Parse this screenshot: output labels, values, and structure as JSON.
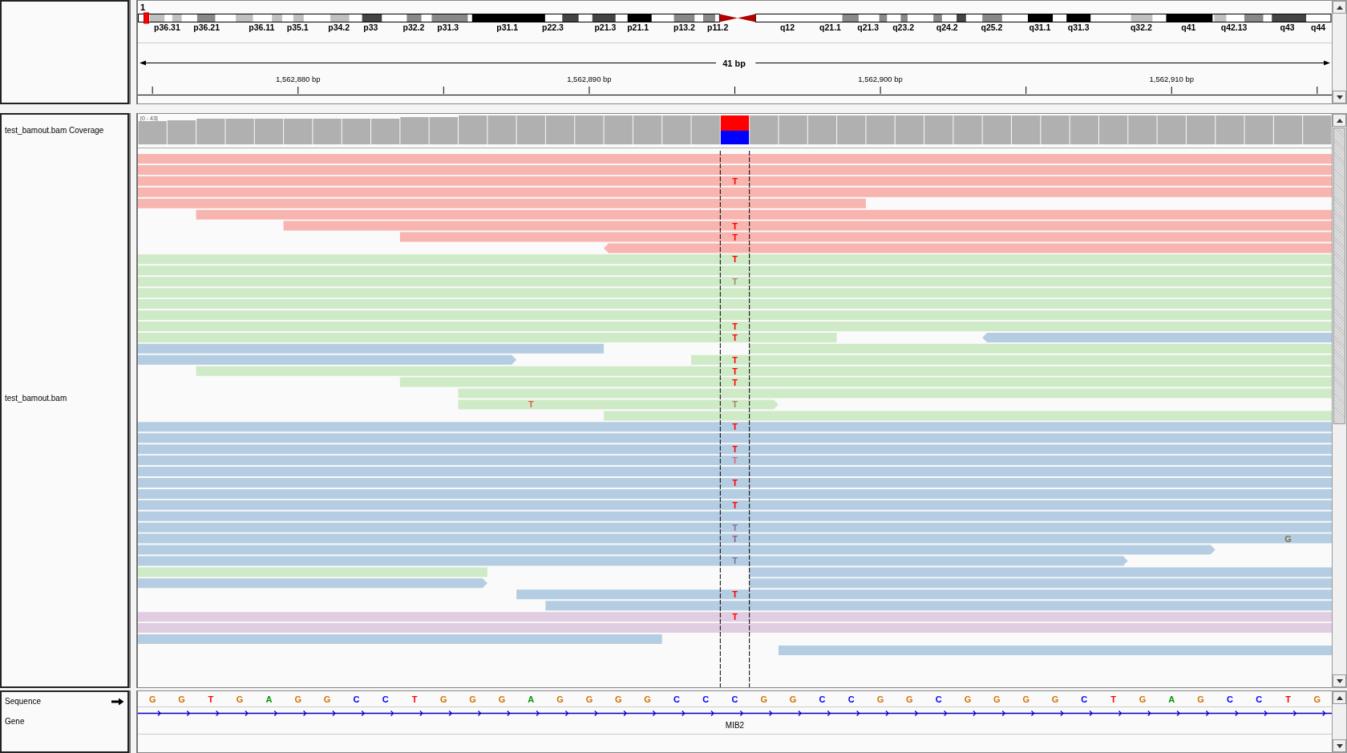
{
  "chromosome": {
    "name": "1",
    "bands": [
      "p36.31",
      "p36.21",
      "p36.11",
      "p35.1",
      "p34.2",
      "p33",
      "p32.2",
      "p31.3",
      "p31.1",
      "p22.3",
      "p21.3",
      "p21.1",
      "p13.2",
      "p11.2",
      "q12",
      "q21.1",
      "q21.3",
      "q23.2",
      "q24.2",
      "q25.2",
      "q31.1",
      "q31.3",
      "q32.2",
      "q41",
      "q42.13",
      "q43",
      "q44"
    ]
  },
  "ruler": {
    "span": "41 bp",
    "ticks": [
      "1,562,880 bp",
      "1,562,890 bp",
      "1,562,900 bp",
      "1,562,910 bp"
    ]
  },
  "coverage_track": {
    "name": "test_bamout.bam Coverage",
    "range_label": "[0 - 43]"
  },
  "alignment_track": {
    "name": "test_bamout.bam",
    "rows": [
      {
        "reads": [
          {
            "color": "#f8b4ae"
          }
        ]
      },
      {
        "reads": [
          {
            "color": "#f8b4ae"
          }
        ]
      },
      {
        "reads": [
          {
            "color": "#f8b4ae",
            "mismatches": [
              {
                "base": "T",
                "color": "#ff0000"
              }
            ]
          }
        ]
      },
      {
        "reads": [
          {
            "color": "#f8b4ae"
          }
        ]
      },
      {
        "reads": [
          {
            "color": "#f8b4ae"
          }
        ]
      },
      {
        "reads": [
          {
            "color": "#f8b4ae"
          }
        ]
      },
      {
        "reads": [
          {
            "color": "#f8b4ae",
            "mismatches": [
              {
                "base": "T",
                "color": "#ff0000"
              }
            ]
          }
        ]
      },
      {
        "reads": [
          {
            "color": "#f8b4ae",
            "mismatches": [
              {
                "base": "T",
                "color": "#ff0000"
              }
            ]
          }
        ]
      },
      {
        "reads": [
          {
            "color": "#f8b4ae"
          }
        ]
      },
      {
        "reads": [
          {
            "color": "#cfeac7",
            "mismatches": [
              {
                "base": "T",
                "color": "#ff0000"
              }
            ]
          }
        ]
      },
      {
        "reads": [
          {
            "color": "#cfeac7"
          }
        ]
      },
      {
        "reads": [
          {
            "color": "#cfeac7",
            "mismatches": [
              {
                "base": "T",
                "color": "#a88870"
              }
            ]
          }
        ]
      },
      {
        "reads": [
          {
            "color": "#cfeac7"
          }
        ]
      },
      {
        "reads": [
          {
            "color": "#cfeac7"
          }
        ]
      },
      {
        "reads": [
          {
            "color": "#cfeac7"
          }
        ]
      },
      {
        "reads": [
          {
            "color": "#cfeac7",
            "mismatches": [
              {
                "base": "T",
                "color": "#ff0000"
              }
            ]
          }
        ]
      },
      {
        "reads": [
          {
            "color": "#cfeac7",
            "mismatches": [
              {
                "base": "T",
                "color": "#ff0000"
              }
            ]
          },
          {
            "color": "#b4cde2"
          }
        ]
      },
      {
        "reads": [
          {
            "color": "#b4cde2"
          },
          {
            "color": "#cfeac7"
          }
        ]
      },
      {
        "reads": [
          {
            "color": "#b4cde2"
          },
          {
            "color": "#cfeac7",
            "mismatches": [
              {
                "base": "T",
                "color": "#ff0000"
              }
            ]
          }
        ]
      },
      {
        "reads": [
          {
            "color": "#cfeac7",
            "mismatches": [
              {
                "base": "T",
                "color": "#ff0000"
              }
            ]
          }
        ]
      },
      {
        "reads": [
          {
            "color": "#cfeac7",
            "mismatches": [
              {
                "base": "T",
                "color": "#ff0000"
              }
            ]
          }
        ]
      },
      {
        "reads": [
          {
            "color": "#cfeac7"
          }
        ]
      },
      {
        "reads": [
          {
            "color": "#cfeac7",
            "mismatches": [
              {
                "base": "T",
                "color": "#e0604f"
              },
              {
                "base": "T",
                "color": "#a08868"
              }
            ]
          }
        ]
      },
      {
        "reads": [
          {
            "color": "#cfeac7"
          }
        ]
      },
      {
        "reads": [
          {
            "color": "#b4cde2",
            "mismatches": [
              {
                "base": "T",
                "color": "#ff0000"
              }
            ]
          }
        ]
      },
      {
        "reads": [
          {
            "color": "#b4cde2"
          }
        ]
      },
      {
        "reads": [
          {
            "color": "#b4cde2",
            "mismatches": [
              {
                "base": "T",
                "color": "#ff0000"
              }
            ]
          }
        ]
      },
      {
        "reads": [
          {
            "color": "#b4cde2",
            "mismatches": [
              {
                "base": "T",
                "color": "#d86878"
              }
            ]
          }
        ]
      },
      {
        "reads": [
          {
            "color": "#b4cde2"
          }
        ]
      },
      {
        "reads": [
          {
            "color": "#b4cde2",
            "mismatches": [
              {
                "base": "T",
                "color": "#ff0000"
              }
            ]
          }
        ]
      },
      {
        "reads": [
          {
            "color": "#b4cde2"
          }
        ]
      },
      {
        "reads": [
          {
            "color": "#b4cde2",
            "mismatches": [
              {
                "base": "T",
                "color": "#ff0000"
              }
            ]
          }
        ]
      },
      {
        "reads": [
          {
            "color": "#b4cde2"
          }
        ]
      },
      {
        "reads": [
          {
            "color": "#b4cde2",
            "mismatches": [
              {
                "base": "T",
                "color": "#7e7298"
              }
            ]
          }
        ]
      },
      {
        "reads": [
          {
            "color": "#b4cde2",
            "mismatches": [
              {
                "base": "T",
                "color": "#8a5c80"
              },
              {
                "base": "G",
                "color": "#7e6c48"
              }
            ]
          }
        ]
      },
      {
        "reads": [
          {
            "color": "#b4cde2"
          }
        ]
      },
      {
        "reads": [
          {
            "color": "#b4cde2",
            "mismatches": [
              {
                "base": "T",
                "color": "#7e7298"
              }
            ]
          }
        ]
      },
      {
        "reads": [
          {
            "color": "#cfeac7"
          },
          {
            "color": "#b4cde2"
          }
        ]
      },
      {
        "reads": [
          {
            "color": "#b4cde2"
          },
          {
            "color": "#b4cde2"
          }
        ]
      },
      {
        "reads": [
          {
            "color": "#b4cde2",
            "mismatches": [
              {
                "base": "T",
                "color": "#ff0000"
              }
            ]
          }
        ]
      },
      {
        "reads": [
          {
            "color": "#b4cde2"
          }
        ]
      },
      {
        "reads": [
          {
            "color": "#e1cde2",
            "mismatches": [
              {
                "base": "T",
                "color": "#ff0000"
              }
            ]
          }
        ]
      },
      {
        "reads": [
          {
            "color": "#e1cde2"
          }
        ]
      },
      {
        "reads": [
          {
            "color": "#b4cde2"
          }
        ]
      },
      {
        "reads": [
          {
            "color": "#b4cde2"
          }
        ]
      }
    ]
  },
  "sequence_track": {
    "name": "Sequence",
    "bases": [
      {
        "base": "G",
        "color": "#d17105"
      },
      {
        "base": "G",
        "color": "#d17105"
      },
      {
        "base": "T",
        "color": "#ff0000"
      },
      {
        "base": "G",
        "color": "#d17105"
      },
      {
        "base": "A",
        "color": "#009600"
      },
      {
        "base": "G",
        "color": "#d17105"
      },
      {
        "base": "G",
        "color": "#d17105"
      },
      {
        "base": "C",
        "color": "#0000ff"
      },
      {
        "base": "C",
        "color": "#0000ff"
      },
      {
        "base": "T",
        "color": "#ff0000"
      },
      {
        "base": "G",
        "color": "#d17105"
      },
      {
        "base": "G",
        "color": "#d17105"
      },
      {
        "base": "G",
        "color": "#d17105"
      },
      {
        "base": "A",
        "color": "#009600"
      },
      {
        "base": "G",
        "color": "#d17105"
      },
      {
        "base": "G",
        "color": "#d17105"
      },
      {
        "base": "G",
        "color": "#d17105"
      },
      {
        "base": "G",
        "color": "#d17105"
      },
      {
        "base": "C",
        "color": "#0000ff"
      },
      {
        "base": "C",
        "color": "#0000ff"
      },
      {
        "base": "C",
        "color": "#0000ff"
      },
      {
        "base": "G",
        "color": "#d17105"
      },
      {
        "base": "G",
        "color": "#d17105"
      },
      {
        "base": "C",
        "color": "#0000ff"
      },
      {
        "base": "C",
        "color": "#0000ff"
      },
      {
        "base": "G",
        "color": "#d17105"
      },
      {
        "base": "G",
        "color": "#d17105"
      },
      {
        "base": "C",
        "color": "#0000ff"
      },
      {
        "base": "G",
        "color": "#d17105"
      },
      {
        "base": "G",
        "color": "#d17105"
      },
      {
        "base": "G",
        "color": "#d17105"
      },
      {
        "base": "G",
        "color": "#d17105"
      },
      {
        "base": "C",
        "color": "#0000ff"
      },
      {
        "base": "T",
        "color": "#ff0000"
      },
      {
        "base": "G",
        "color": "#d17105"
      },
      {
        "base": "A",
        "color": "#009600"
      },
      {
        "base": "G",
        "color": "#d17105"
      },
      {
        "base": "C",
        "color": "#0000ff"
      },
      {
        "base": "C",
        "color": "#0000ff"
      },
      {
        "base": "T",
        "color": "#ff0000"
      },
      {
        "base": "G",
        "color": "#d17105"
      }
    ]
  },
  "gene_track": {
    "name": "Gene",
    "genes": [
      {
        "name": "MIB2"
      }
    ]
  }
}
